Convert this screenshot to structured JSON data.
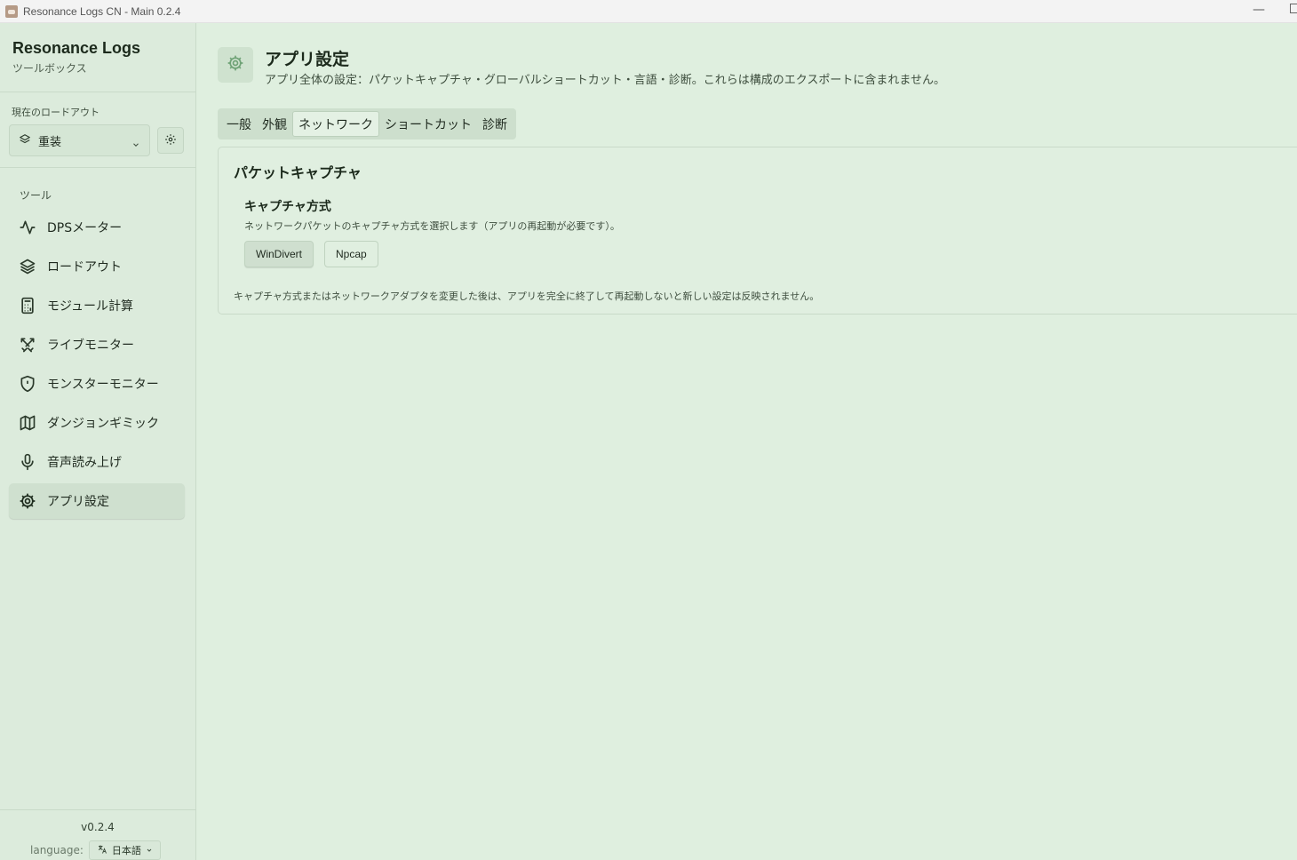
{
  "window": {
    "title": "Resonance Logs CN - Main 0.2.4",
    "minimize_glyph": "—"
  },
  "sidebar": {
    "brand_title": "Resonance Logs",
    "brand_subtitle": "ツールボックス",
    "loadout_label": "現在のロードアウト",
    "loadout_value": "重装",
    "tools_label": "ツール",
    "items": [
      {
        "label": "DPSメーター",
        "icon": "activity-icon"
      },
      {
        "label": "ロードアウト",
        "icon": "layers-icon"
      },
      {
        "label": "モジュール計算",
        "icon": "calculator-icon"
      },
      {
        "label": "ライブモニター",
        "icon": "crossed-swords-icon"
      },
      {
        "label": "モンスターモニター",
        "icon": "shield-alert-icon"
      },
      {
        "label": "ダンジョンギミック",
        "icon": "map-icon"
      },
      {
        "label": "音声読み上げ",
        "icon": "mic-icon"
      },
      {
        "label": "アプリ設定",
        "icon": "gear-icon",
        "active": true
      }
    ],
    "version": "v0.2.4",
    "language_label": "language:",
    "language_value": "日本語"
  },
  "main": {
    "title": "アプリ設定",
    "subtitle": "アプリ全体の設定：パケットキャプチャ・グローバルショートカット・言語・診断。これらは構成のエクスポートに含まれません。",
    "tabs": [
      {
        "label": "一般"
      },
      {
        "label": "外観"
      },
      {
        "label": "ネットワーク",
        "active": true
      },
      {
        "label": "ショートカット"
      },
      {
        "label": "診断"
      }
    ],
    "panel": {
      "title": "パケットキャプチャ",
      "field_label": "キャプチャ方式",
      "field_description": "ネットワークパケットのキャプチャ方式を選択します（アプリの再起動が必要です）。",
      "options": [
        "WinDivert",
        "Npcap"
      ],
      "selected_option": "WinDivert",
      "note": "キャプチャ方式またはネットワークアダプタを変更した後は、アプリを完全に終了して再起動しないと新しい設定は反映されません。"
    }
  },
  "colors": {
    "background": "#dfefdf",
    "sidebar": "#dcebdc",
    "active": "#cfe0cf",
    "icon_accent": "#6fa276"
  }
}
